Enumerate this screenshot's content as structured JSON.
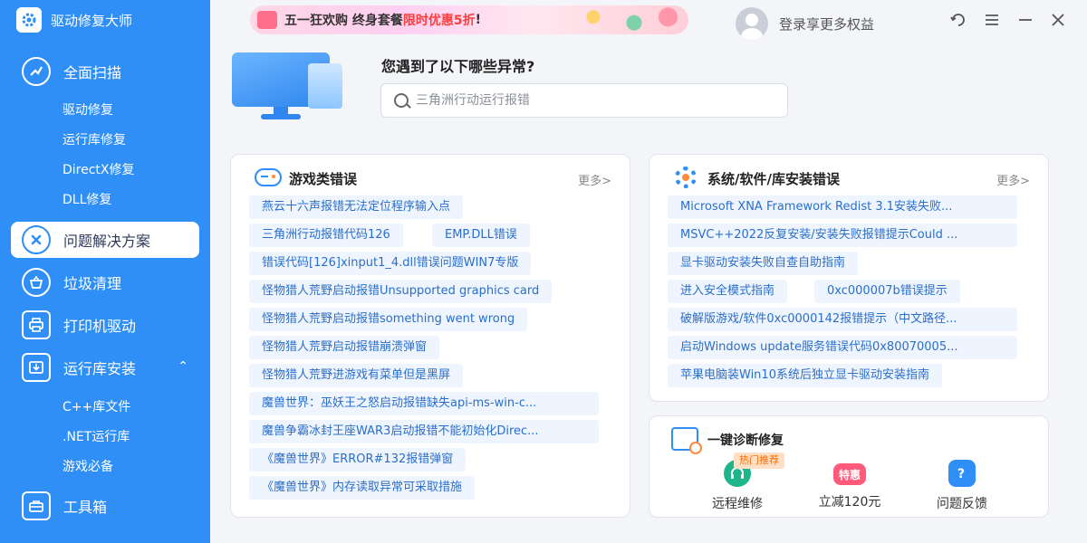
{
  "app": {
    "title": "驱动修复大师"
  },
  "sidebar": {
    "main": [
      {
        "id": "scan",
        "label": "全面扫描",
        "icon": "scan-icon"
      },
      {
        "id": "solutions",
        "label": "问题解决方案",
        "icon": "x-circle-icon",
        "active": true
      },
      {
        "id": "clean",
        "label": "垃圾清理",
        "icon": "basket-icon"
      },
      {
        "id": "printer",
        "label": "打印机驱动",
        "icon": "printer-icon"
      },
      {
        "id": "runtime",
        "label": "运行库安装",
        "icon": "download-box-icon",
        "expanded": true
      },
      {
        "id": "toolbox",
        "label": "工具箱",
        "icon": "toolbox-icon"
      }
    ],
    "scan_sub": [
      "驱动修复",
      "运行库修复",
      "DirectX修复",
      "DLL修复"
    ],
    "runtime_sub": [
      "C++库文件",
      ".NET运行库",
      "游戏必备"
    ]
  },
  "banner": {
    "prefix": "五一狂欢购 终身套餐",
    "highlight": "限时优惠5折",
    "suffix": "!"
  },
  "header": {
    "login_text": "登录享更多权益"
  },
  "hero": {
    "question": "您遇到了以下哪些异常?",
    "search_placeholder": "三角洲行动运行报错"
  },
  "game_card": {
    "title": "游戏类错误",
    "more": "更多>",
    "tags": [
      "燕云十六声报错无法定位程序输入点",
      "三角洲行动报错代码126",
      "EMP.DLL错误",
      "错误代码[126]xinput1_4.dll错误问题WIN7专版",
      "怪物猎人荒野启动报错Unsupported graphics card",
      "怪物猎人荒野启动报错something went wrong",
      "怪物猎人荒野启动报错崩溃弹窗",
      "怪物猎人荒野进游戏有菜单但是黑屏",
      "魔兽世界：巫妖王之怒启动报错缺失api-ms-win-c...",
      "魔兽争霸冰封王座WAR3启动报错不能初始化Direc...",
      "《魔兽世界》ERROR#132报错弹窗",
      "《魔兽世界》内存读取异常可采取措施"
    ]
  },
  "system_card": {
    "title": "系统/软件/库安装错误",
    "more": "更多>",
    "tags": [
      "Microsoft XNA Framework Redist 3.1安装失败...",
      "MSVC++2022反复安装/安装失败报错提示Could ...",
      "显卡驱动安装失败自查自助指南",
      "进入安全模式指南",
      "0xc000007b错误提示",
      "破解版游戏/软件0xc0000142报错提示（中文路径...",
      "启动Windows update服务错误代码0x80070005...",
      "苹果电脑装Win10系统后独立显卡驱动安装指南"
    ]
  },
  "diag_card": {
    "title": "一键诊断修复",
    "hot_badge": "热门推荐",
    "special_badge": "特惠",
    "items": [
      {
        "label": "远程维修",
        "icon": "headset-icon",
        "color": "#1fb58a"
      },
      {
        "label": "立减120元",
        "icon": "discount-icon",
        "color": "#ff5a7a"
      },
      {
        "label": "问题反馈",
        "icon": "feedback-icon",
        "color": "#2f8ff6"
      }
    ]
  }
}
